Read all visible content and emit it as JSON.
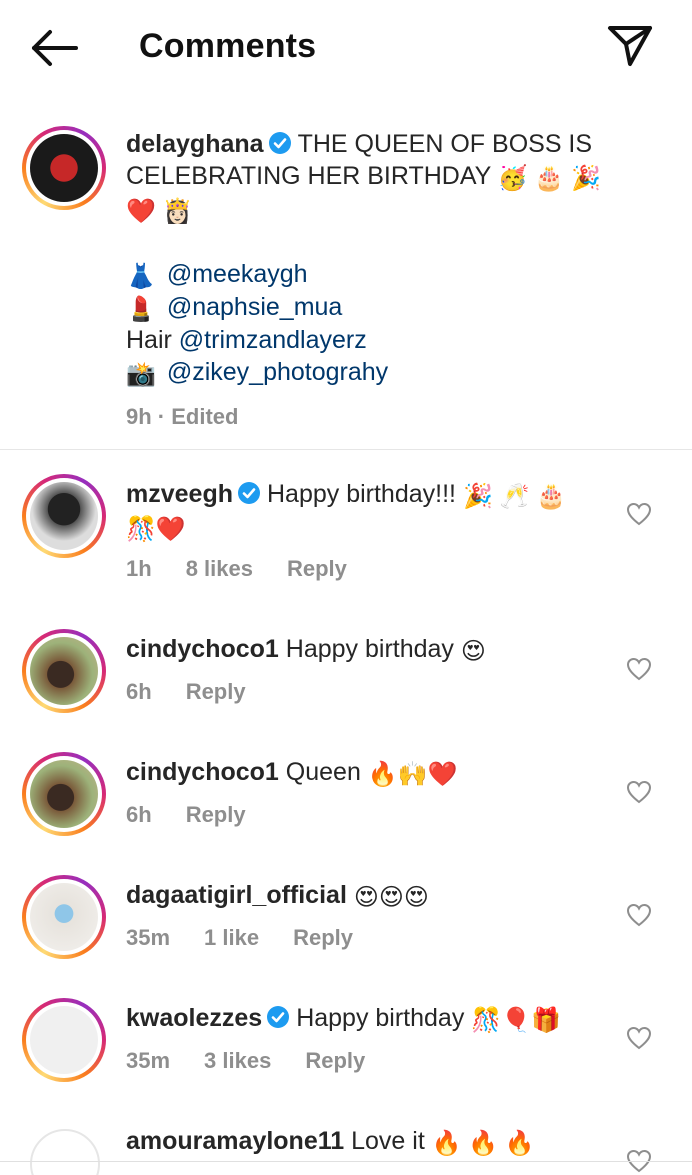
{
  "header": {
    "title": "Comments",
    "back_icon": "arrow-left-icon",
    "share_icon": "paper-plane-icon"
  },
  "colors": {
    "mention": "#00376b",
    "meta": "#8e8e8e",
    "verified": "#1d9bf0",
    "heart_like": "#ed4956"
  },
  "caption": {
    "username": "delayghana",
    "verified": true,
    "text": "THE QUEEN OF BOSS IS CELEBRATING HER BIRTHDAY",
    "emojis": "🥳 🎂 🎉",
    "emojis2": "❤️ 👸🏻",
    "credits": [
      {
        "prefix": "👗",
        "mention": "@meekaygh"
      },
      {
        "prefix": "💄",
        "mention": "@naphsie_mua"
      },
      {
        "prefix": "Hair",
        "mention": "@trimzandlayerz"
      },
      {
        "prefix": "📸",
        "mention": "@zikey_photograhy"
      }
    ],
    "time": "9h",
    "edited": "Edited"
  },
  "comments": [
    {
      "username": "mzveegh",
      "verified": true,
      "text": "Happy birthday!!!",
      "emojis": "🎉 🥂 🎂",
      "emojis2": "🎊❤️",
      "time": "1h",
      "likes": "8 likes",
      "reply": "Reply"
    },
    {
      "username": "cindychoco1",
      "verified": false,
      "text": "Happy birthday",
      "emojis": "😍",
      "time": "6h",
      "reply": "Reply"
    },
    {
      "username": "cindychoco1",
      "verified": false,
      "text": "Queen",
      "emojis": "🔥🙌❤️",
      "time": "6h",
      "reply": "Reply"
    },
    {
      "username": "dagaatigirl_official",
      "verified": false,
      "text": "",
      "emojis": "😍😍😍",
      "time": "35m",
      "likes": "1 like",
      "reply": "Reply"
    },
    {
      "username": "kwaolezzes",
      "verified": true,
      "text": "Happy birthday",
      "emojis": "🎊🎈🎁",
      "time": "35m",
      "likes": "3 likes",
      "reply": "Reply"
    },
    {
      "username": "amouramaylone11",
      "verified": false,
      "text": "Love it",
      "emojis": "🔥 🔥 🔥"
    }
  ]
}
